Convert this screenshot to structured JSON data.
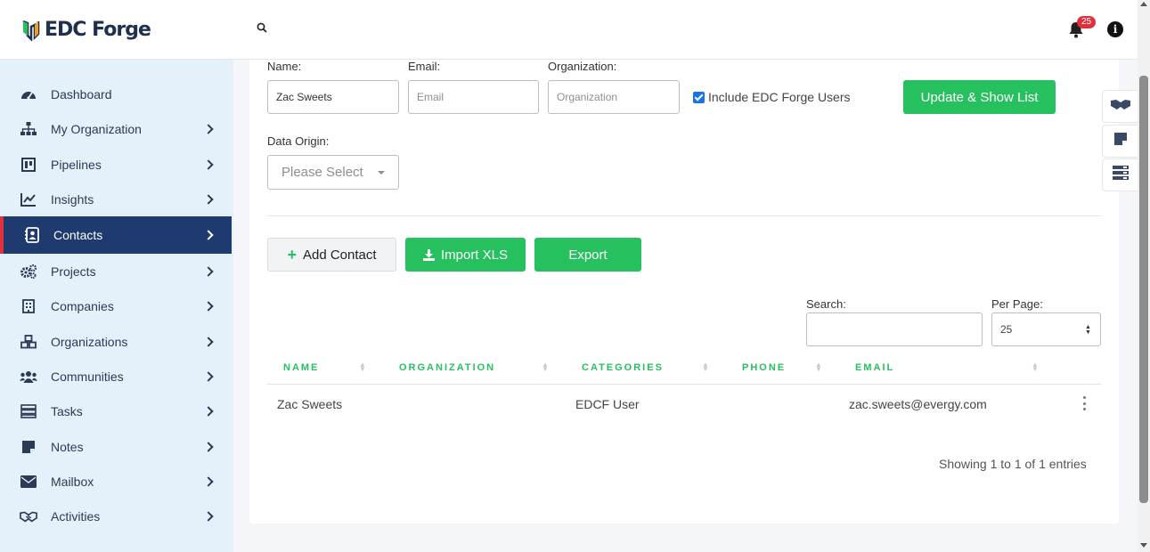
{
  "header": {
    "logo_text": "EDC Forge",
    "notification_count": "25",
    "info_glyph": "i"
  },
  "sidebar": {
    "items": [
      {
        "label": "Dashboard",
        "icon": "dashboard-icon",
        "has_chevron": false
      },
      {
        "label": "My Organization",
        "icon": "org-chart-icon",
        "has_chevron": true
      },
      {
        "label": "Pipelines",
        "icon": "pipeline-icon",
        "has_chevron": true
      },
      {
        "label": "Insights",
        "icon": "chart-line-icon",
        "has_chevron": true
      },
      {
        "label": "Contacts",
        "icon": "address-book-icon",
        "has_chevron": true,
        "active": true
      },
      {
        "label": "Projects",
        "icon": "gears-icon",
        "has_chevron": true
      },
      {
        "label": "Companies",
        "icon": "building-icon",
        "has_chevron": true
      },
      {
        "label": "Organizations",
        "icon": "cubes-icon",
        "has_chevron": true
      },
      {
        "label": "Communities",
        "icon": "users-icon",
        "has_chevron": true
      },
      {
        "label": "Tasks",
        "icon": "tasks-icon",
        "has_chevron": true
      },
      {
        "label": "Notes",
        "icon": "note-icon",
        "has_chevron": true
      },
      {
        "label": "Mailbox",
        "icon": "envelope-icon",
        "has_chevron": true
      },
      {
        "label": "Activities",
        "icon": "handshake-icon",
        "has_chevron": true
      }
    ]
  },
  "filters": {
    "name_label": "Name:",
    "name_value": "Zac Sweets",
    "email_label": "Email:",
    "email_placeholder": "Email",
    "org_label": "Organization:",
    "org_placeholder": "Organization",
    "include_label": "Include EDC Forge Users",
    "include_checked": true,
    "update_button": "Update & Show List",
    "data_origin_label": "Data Origin:",
    "data_origin_value": "Please Select"
  },
  "actions": {
    "add_contact": "Add Contact",
    "add_glyph": "+",
    "import": "Import XLS",
    "export": "Export"
  },
  "table_controls": {
    "search_label": "Search:",
    "per_page_label": "Per Page:",
    "per_page_value": "25"
  },
  "table": {
    "columns": [
      "NAME",
      "ORGANIZATION",
      "CATEGORIES",
      "PHONE",
      "EMAIL"
    ],
    "rows": [
      {
        "name": "Zac Sweets",
        "organization": "",
        "categories": "EDCF User",
        "phone": "",
        "email": "zac.sweets@evergy.com"
      }
    ],
    "footer": "Showing 1 to 1 of 1 entries"
  },
  "colors": {
    "accent_green": "#27c05f",
    "nav_active_bg": "#1e3a6e",
    "sidebar_bg": "#e4f1fb",
    "badge_red": "#e0303d"
  }
}
